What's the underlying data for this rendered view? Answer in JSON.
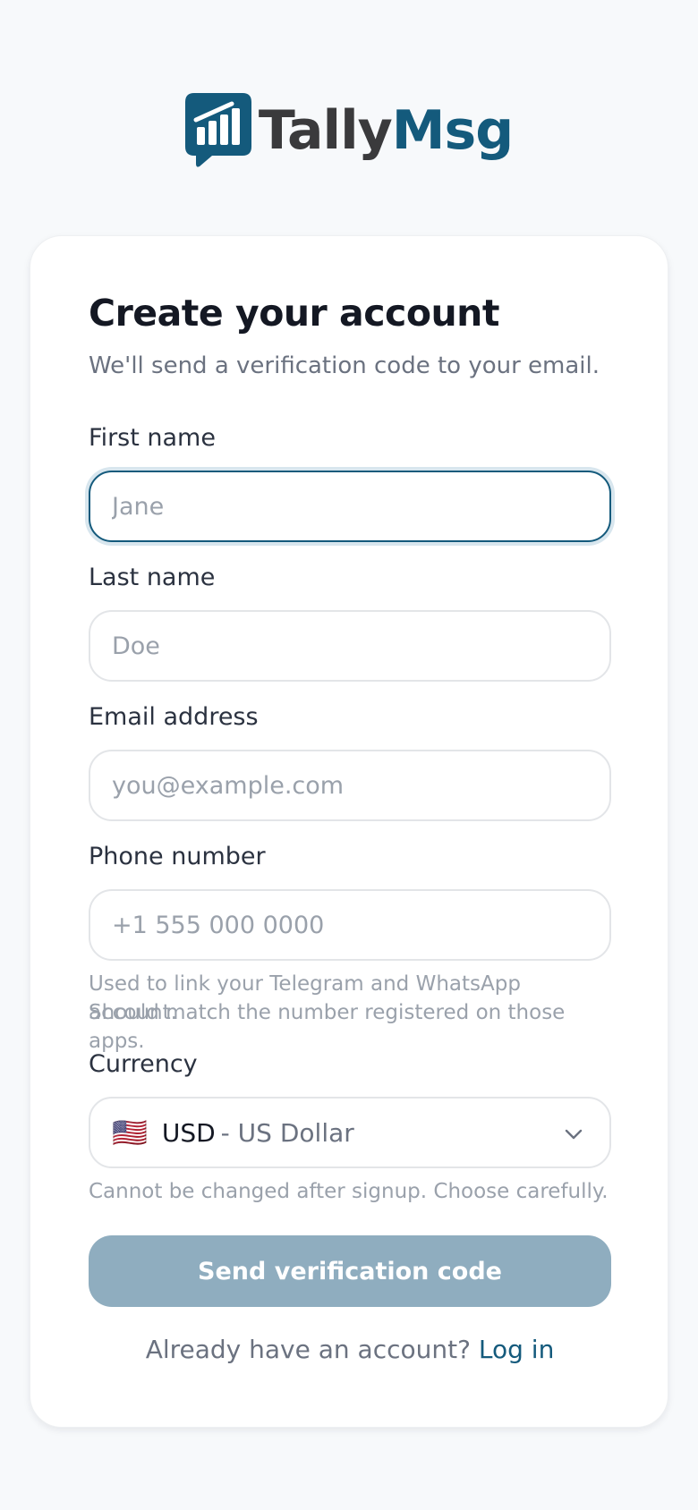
{
  "brand": {
    "name_part1": "Tally",
    "name_part2": "Msg"
  },
  "form": {
    "title": "Create your account",
    "subtitle": "We'll send a verification code to your email.",
    "first_name": {
      "label": "First name",
      "placeholder": "Jane"
    },
    "last_name": {
      "label": "Last name",
      "placeholder": "Doe"
    },
    "email": {
      "label": "Email address",
      "placeholder": "you@example.com"
    },
    "phone": {
      "label": "Phone number",
      "placeholder": "+1 555 000 0000",
      "hint_line1": "Used to link your Telegram and WhatsApp account.",
      "hint_line2": "Should match the number registered on those apps."
    },
    "currency": {
      "label": "Currency",
      "flag": "🇺🇸",
      "code": "USD",
      "name": "- US Dollar",
      "hint": "Cannot be changed after signup. Choose carefully."
    },
    "submit_label": "Send verification code",
    "footer_text": "Already have an account?",
    "login_link": "Log in"
  },
  "colors": {
    "brand": "#145a7c",
    "button_disabled": "#8fadbf",
    "background": "#f7f9fb"
  },
  "icons": {
    "logo": "chat-bar-chart-icon",
    "select_caret": "chevron-down-icon"
  }
}
